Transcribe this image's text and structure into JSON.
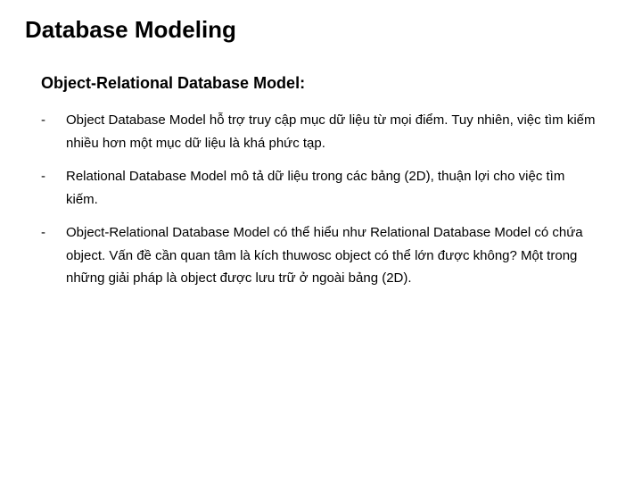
{
  "title": "Database Modeling",
  "subtitle": "Object-Relational Database Model:",
  "bullets": [
    "Object Database Model hỗ trợ truy cập mục dữ liệu từ mọi điểm. Tuy nhiên, việc tìm kiếm nhiều hơn một mục dữ liệu là khá phức tạp.",
    "Relational Database Model mô tả dữ liệu trong các bảng (2D), thuận lợi cho việc tìm kiếm.",
    "Object-Relational Database Model có thể hiểu như Relational Database Model có chứa object. Vấn đề cần quan tâm là kích thuwosc object có thể lớn được không? Một trong những giải pháp là object được lưu trữ ở ngoài bảng (2D)."
  ]
}
